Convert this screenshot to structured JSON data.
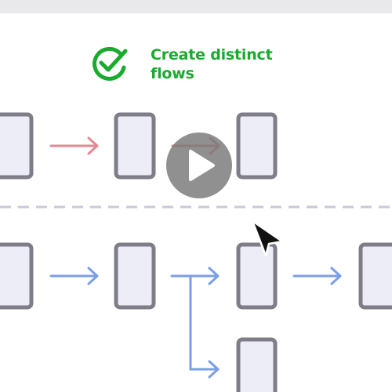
{
  "heading": {
    "line1": "Create distinct",
    "line2": "flows"
  },
  "colors": {
    "accent_green": "#1aaa2e",
    "flow_red": "#e28a93",
    "flow_blue": "#7b9ee8",
    "screen_fill": "#ecedf6",
    "screen_stroke": "#7e7d88",
    "divider": "#c9cad8",
    "play_overlay": "#7a7a7a",
    "top_bar": "#e9e9ec"
  },
  "icons": {
    "check": "check-circle-icon",
    "play": "play-icon",
    "cursor": "mouse-pointer-icon"
  }
}
